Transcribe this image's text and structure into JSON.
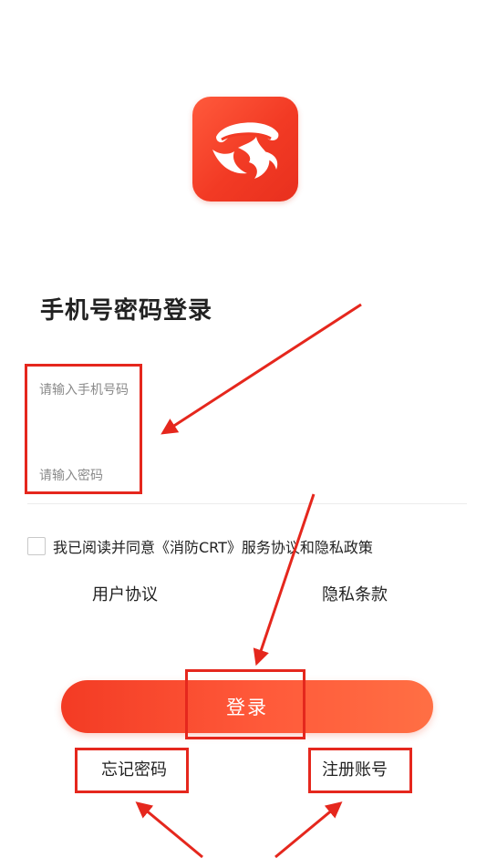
{
  "app": {
    "logo_icon": "fire-bird-logo-icon",
    "brand_color": "#f33b24"
  },
  "title": "手机号密码登录",
  "form": {
    "phone_placeholder": "请输入手机号码",
    "phone_value": "",
    "password_placeholder": "请输入密码",
    "password_value": ""
  },
  "agreement": {
    "checked": false,
    "text": "我已阅读并同意《消防CRT》服务协议和隐私政策",
    "user_agreement_label": "用户协议",
    "privacy_label": "隐私条款"
  },
  "actions": {
    "login_label": "登录",
    "forgot_password_label": "忘记密码",
    "register_label": "注册账号"
  },
  "annotation": {
    "color": "#e5271d"
  }
}
